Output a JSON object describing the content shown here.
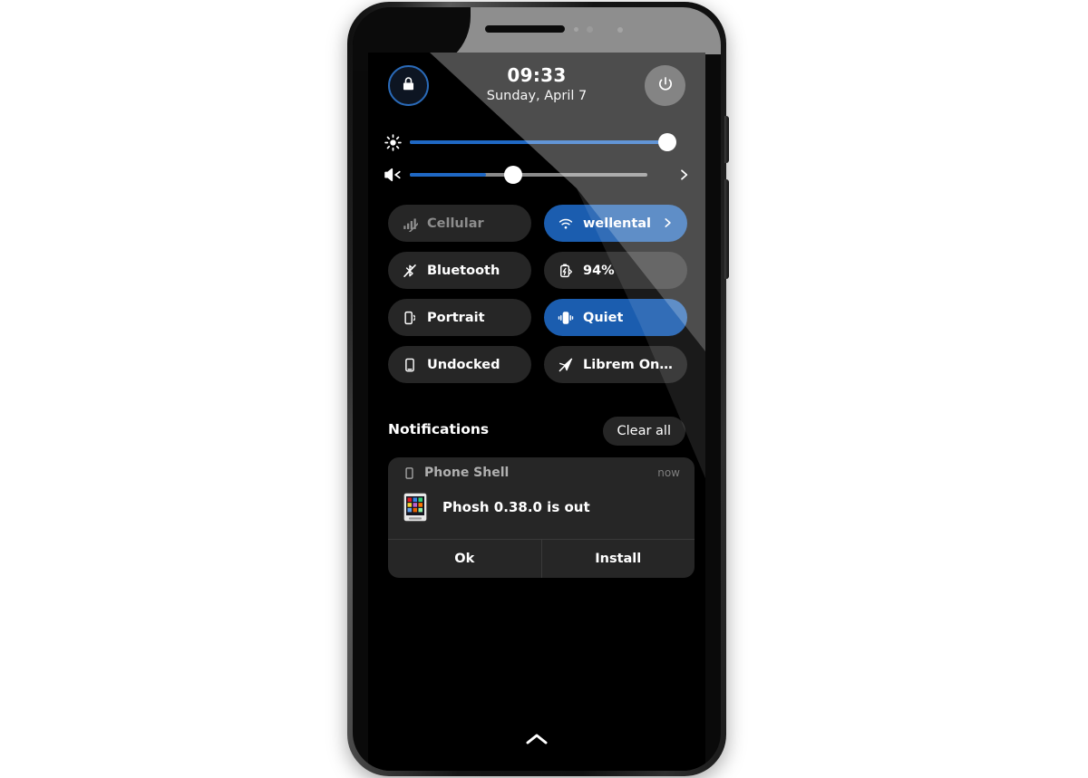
{
  "device": {
    "name": "linux-phone-mockup",
    "shell": "Phosh"
  },
  "status": {
    "time": "09:33",
    "date": "Sunday, April 7"
  },
  "top_actions": {
    "lock_label": "lock-screen",
    "lock_icon": "lock-icon",
    "power_label": "power-menu",
    "power_icon": "power-icon"
  },
  "sliders": [
    {
      "name": "brightness",
      "icon": "brightness-icon",
      "value": 100,
      "has_chevron": false
    },
    {
      "name": "volume",
      "icon": "volume-mute-icon",
      "value": 30,
      "has_chevron": true,
      "chevron_icon": "chevron-right-icon"
    }
  ],
  "toggles": [
    {
      "label": "Cellular",
      "icon": "cellular-off-icon",
      "active": false,
      "dim": true,
      "arrow": false
    },
    {
      "label": "wellental",
      "icon": "wifi-icon",
      "active": true,
      "dim": false,
      "arrow": true
    },
    {
      "label": "Bluetooth",
      "icon": "bluetooth-off-icon",
      "active": false,
      "dim": false,
      "arrow": false
    },
    {
      "label": "94%",
      "icon": "battery-charging-icon",
      "active": false,
      "dim": false,
      "arrow": false
    },
    {
      "label": "Portrait",
      "icon": "rotate-lock-icon",
      "active": false,
      "dim": false,
      "arrow": false
    },
    {
      "label": "Quiet",
      "icon": "vibrate-icon",
      "active": true,
      "dim": false,
      "arrow": false
    },
    {
      "label": "Undocked",
      "icon": "dock-icon",
      "active": false,
      "dim": false,
      "arrow": false
    },
    {
      "label": "Librem One Finl…",
      "icon": "vpn-off-icon",
      "active": false,
      "dim": false,
      "arrow": false
    }
  ],
  "notifications": {
    "header": "Notifications",
    "clear_all": "Clear all",
    "items": [
      {
        "source": "Phone Shell",
        "source_icon": "phone-outline-icon",
        "time": "now",
        "app_icon": "phosh-app-grid-icon",
        "summary": "Phosh 0.38.0 is out",
        "actions": [
          "Ok",
          "Install"
        ]
      }
    ]
  },
  "bottom_bar": {
    "handle_icon": "chevron-up-icon"
  },
  "colors": {
    "accent_blue": "#1b5daf",
    "slider_blue": "#1f68c4",
    "lock_ring": "#2a6ab8",
    "surface": "#262626",
    "screen_bg": "#000000",
    "text_primary": "#ffffff",
    "text_dim": "#8d8d8d"
  }
}
